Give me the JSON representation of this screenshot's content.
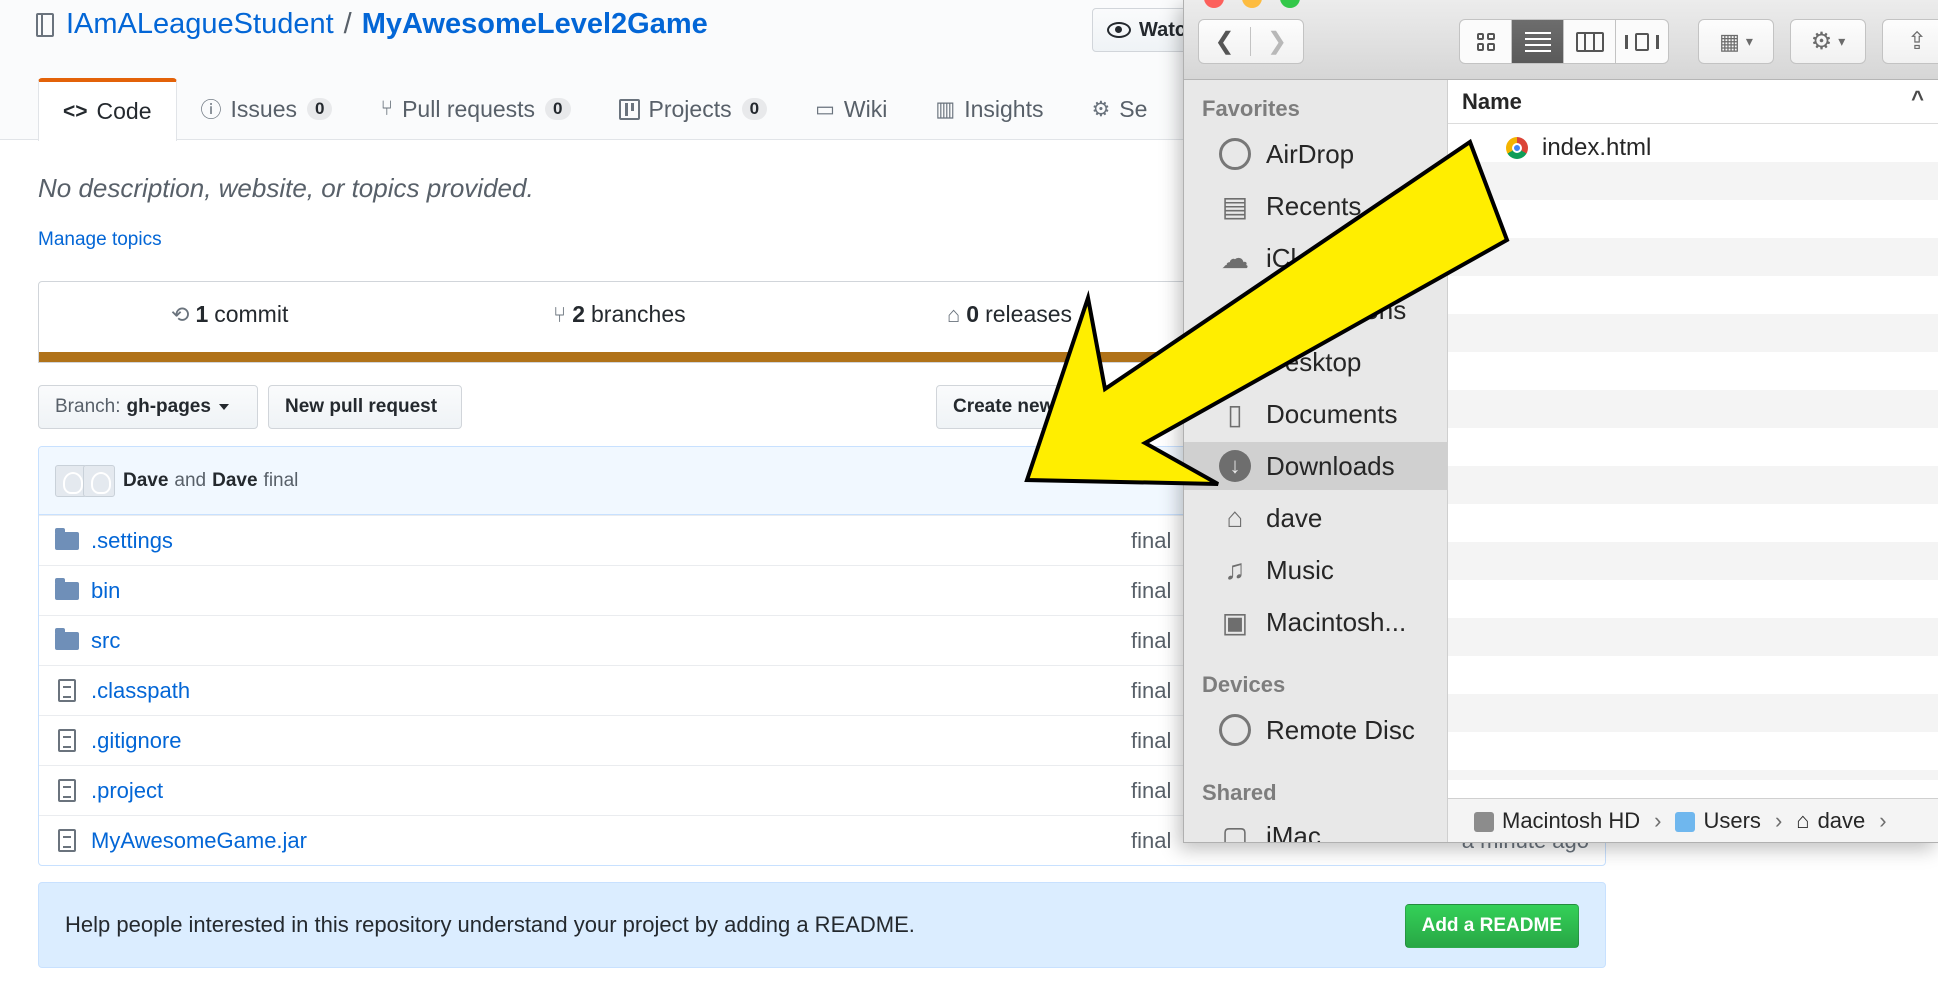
{
  "github": {
    "repo_owner": "IAmALeagueStudent",
    "separator": "/",
    "repo_name": "MyAwesomeLevel2Game",
    "watch_label": "Watc",
    "tabs": [
      {
        "icon": "<>",
        "label": "Code",
        "count": null
      },
      {
        "icon": "ⓘ",
        "label": "Issues",
        "count": "0"
      },
      {
        "icon": "⑂",
        "label": "Pull requests",
        "count": "0"
      },
      {
        "icon": "",
        "label": "Projects",
        "count": "0"
      },
      {
        "icon": "▭",
        "label": "Wiki",
        "count": null
      },
      {
        "icon": "▥",
        "label": "Insights",
        "count": null
      },
      {
        "icon": "⚙",
        "label": "Se",
        "count": null
      }
    ],
    "description": "No description, website, or topics provided.",
    "manage_topics": "Manage topics",
    "summary": {
      "commits_count": "1",
      "commits_label": "commit",
      "branches_count": "2",
      "branches_label": "branches",
      "releases_count": "0",
      "releases_label": "releases"
    },
    "language_bar_color": "#b07219",
    "branch_label": "Branch:",
    "branch_value": "gh-pages",
    "new_pr_label": "New pull request",
    "create_new_label": "Create new",
    "commit": {
      "author1": "Dave",
      "and": "and",
      "author2": "Dave",
      "message": "final"
    },
    "files": [
      {
        "type": "dir",
        "name": ".settings",
        "message": "final"
      },
      {
        "type": "dir",
        "name": "bin",
        "message": "final"
      },
      {
        "type": "dir",
        "name": "src",
        "message": "final"
      },
      {
        "type": "file",
        "name": ".classpath",
        "message": "final"
      },
      {
        "type": "file",
        "name": ".gitignore",
        "message": "final"
      },
      {
        "type": "file",
        "name": ".project",
        "message": "final"
      },
      {
        "type": "file",
        "name": "MyAwesomeGame.jar",
        "message": "final",
        "age": "a minute ago"
      }
    ],
    "readme_prompt": "Help people interested in this repository understand your project by adding a README.",
    "readme_button": "Add a README"
  },
  "finder": {
    "sidebar": {
      "favorites_header": "Favorites",
      "favorites": [
        {
          "icon": "airdrop-icon",
          "label": "AirDrop"
        },
        {
          "icon": "recents-icon",
          "label": "Recents"
        },
        {
          "icon": "cloud-icon",
          "label": "iCl"
        },
        {
          "icon": "applications-icon",
          "label": "Applications"
        },
        {
          "icon": "desktop-icon",
          "label": "Desktop"
        },
        {
          "icon": "documents-icon",
          "label": "Documents"
        },
        {
          "icon": "downloads-icon",
          "label": "Downloads",
          "selected": true
        },
        {
          "icon": "home-icon",
          "label": "dave"
        },
        {
          "icon": "music-icon",
          "label": "Music"
        },
        {
          "icon": "harddisk-icon",
          "label": "Macintosh..."
        }
      ],
      "devices_header": "Devices",
      "devices": [
        {
          "icon": "disc-icon",
          "label": "Remote Disc"
        }
      ],
      "shared_header": "Shared",
      "shared": [
        {
          "icon": "imac-icon",
          "label": "iMac"
        }
      ]
    },
    "column_header": "Name",
    "sort_indicator": "^",
    "file": "index.html",
    "path": [
      "Macintosh HD",
      "Users",
      "dave"
    ]
  },
  "arrow": {
    "color": "#ffee00",
    "outline": "#000000"
  }
}
